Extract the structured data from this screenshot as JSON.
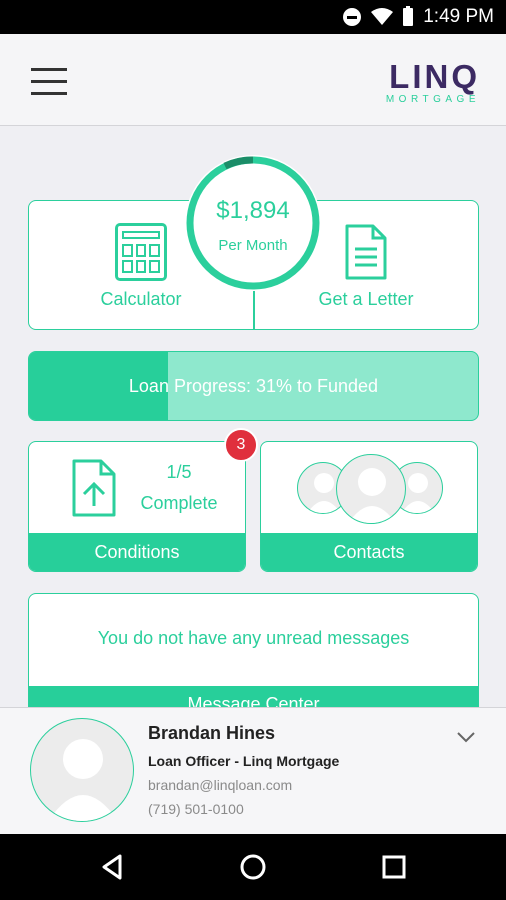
{
  "status_bar": {
    "time": "1:49 PM",
    "icons": [
      "do-not-disturb-icon",
      "wifi-icon",
      "battery-icon"
    ]
  },
  "header": {
    "menu_icon": "hamburger-menu-icon",
    "logo_main": "LINQ",
    "logo_sub": "MORTGAGE"
  },
  "payment": {
    "amount": "$1,894",
    "period": "Per Month"
  },
  "actions": {
    "calculator": "Calculator",
    "letter": "Get a Letter"
  },
  "progress": {
    "label": "Loan Progress: 31% to Funded",
    "percent": 31
  },
  "conditions": {
    "count": "1/5",
    "status": "Complete",
    "label": "Conditions",
    "badge": "3"
  },
  "contacts": {
    "label": "Contacts"
  },
  "messages": {
    "text": "You do not have any unread messages",
    "label": "Message Center"
  },
  "officer": {
    "name": "Brandan Hines",
    "title": "Loan Officer - Linq Mortgage",
    "email": "brandan@linqloan.com",
    "phone": "(719) 501-0100"
  },
  "colors": {
    "accent": "#2bcf9c",
    "brand": "#3c2a63",
    "badge": "#e0303d"
  },
  "nav": {
    "icons": [
      "back-icon",
      "home-icon",
      "recents-icon"
    ]
  }
}
